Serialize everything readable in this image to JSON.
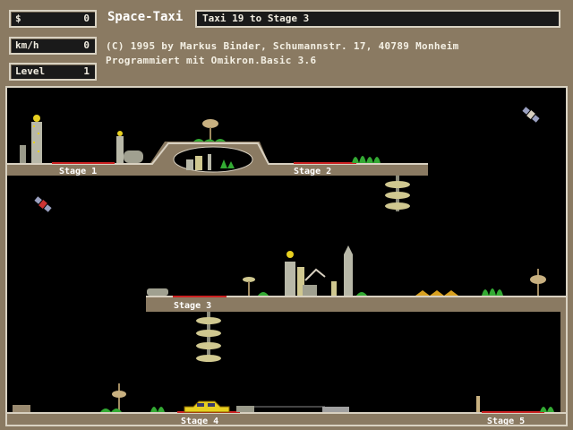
{
  "hud": {
    "money_label": "$",
    "money_value": "0",
    "speed_label": "km/h",
    "speed_value": "0",
    "level_label": "Level",
    "level_value": "1"
  },
  "title": "Space-Taxi",
  "status": "Taxi  19 to Stage   3",
  "info_line1": "(C) 1995 by Markus Binder, Schumannstr. 17, 40789 Monheim",
  "info_line2": "Programmiert mit Omikron.Basic 3.6",
  "stages": {
    "s1": "Stage 1",
    "s2": "Stage 2",
    "s3": "Stage 3",
    "s4": "Stage 4",
    "s5": "Stage 5"
  },
  "colors": {
    "frame": "#8a7a62",
    "ground": "#c8bfae",
    "pad": "#cc2222",
    "taxi": "#e8d020",
    "plant": "#33aa33"
  }
}
